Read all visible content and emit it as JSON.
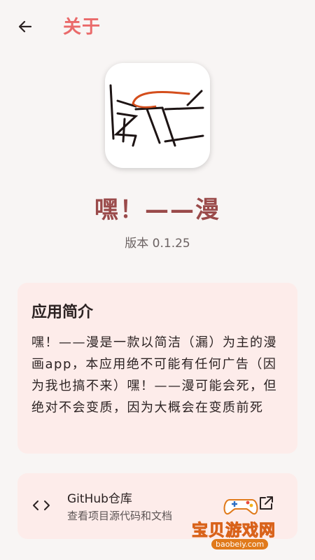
{
  "appbar": {
    "title": "关于"
  },
  "app": {
    "name": "嘿！——漫",
    "version": "版本 0.1.25"
  },
  "intro": {
    "title": "应用简介",
    "body": "嘿！——漫是一款以简洁（漏）为主的漫画app，本应用绝不可能有任何广告（因为我也搞不来）嘿！——漫可能会死，但绝对不会变质，因为大概会在变质前死"
  },
  "github": {
    "title": "GitHub仓库",
    "subtitle": "查看项目源代码和文档"
  },
  "watermark": {
    "text": "宝贝游戏网",
    "url": "baobeiy.com"
  },
  "colors": {
    "accent": "#ea6a6a",
    "app_name": "#9a4a4a",
    "card_bg": "#fdecea",
    "background": "#f8f5f4"
  },
  "icons": {
    "back": "arrow-left-icon",
    "code": "code-brackets-icon",
    "external": "open-external-icon",
    "logo": "app-logo-icon"
  }
}
